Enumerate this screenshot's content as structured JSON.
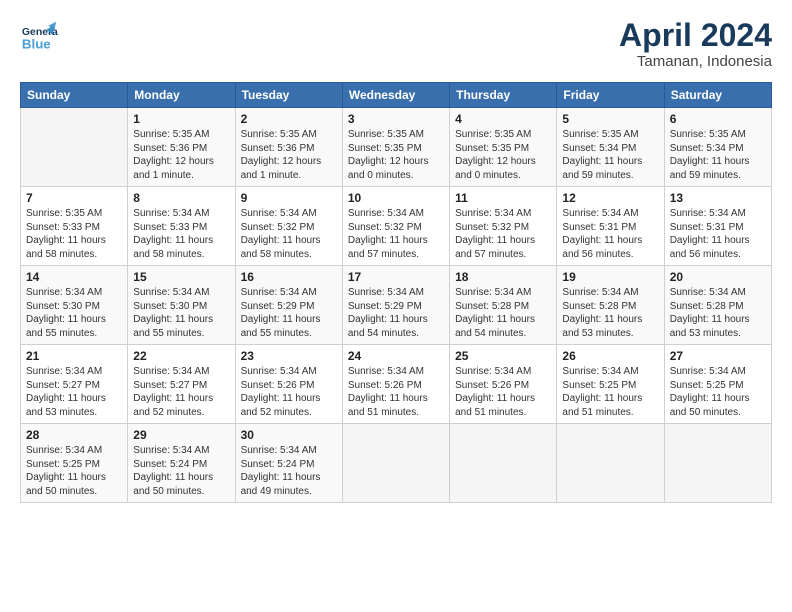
{
  "header": {
    "logo_general": "General",
    "logo_blue": "Blue",
    "title": "April 2024",
    "subtitle": "Tamanan, Indonesia"
  },
  "weekdays": [
    "Sunday",
    "Monday",
    "Tuesday",
    "Wednesday",
    "Thursday",
    "Friday",
    "Saturday"
  ],
  "weeks": [
    [
      {
        "day": "",
        "info": ""
      },
      {
        "day": "1",
        "info": "Sunrise: 5:35 AM\nSunset: 5:36 PM\nDaylight: 12 hours\nand 1 minute."
      },
      {
        "day": "2",
        "info": "Sunrise: 5:35 AM\nSunset: 5:36 PM\nDaylight: 12 hours\nand 1 minute."
      },
      {
        "day": "3",
        "info": "Sunrise: 5:35 AM\nSunset: 5:35 PM\nDaylight: 12 hours\nand 0 minutes."
      },
      {
        "day": "4",
        "info": "Sunrise: 5:35 AM\nSunset: 5:35 PM\nDaylight: 12 hours\nand 0 minutes."
      },
      {
        "day": "5",
        "info": "Sunrise: 5:35 AM\nSunset: 5:34 PM\nDaylight: 11 hours\nand 59 minutes."
      },
      {
        "day": "6",
        "info": "Sunrise: 5:35 AM\nSunset: 5:34 PM\nDaylight: 11 hours\nand 59 minutes."
      }
    ],
    [
      {
        "day": "7",
        "info": "Sunrise: 5:35 AM\nSunset: 5:33 PM\nDaylight: 11 hours\nand 58 minutes."
      },
      {
        "day": "8",
        "info": "Sunrise: 5:34 AM\nSunset: 5:33 PM\nDaylight: 11 hours\nand 58 minutes."
      },
      {
        "day": "9",
        "info": "Sunrise: 5:34 AM\nSunset: 5:32 PM\nDaylight: 11 hours\nand 58 minutes."
      },
      {
        "day": "10",
        "info": "Sunrise: 5:34 AM\nSunset: 5:32 PM\nDaylight: 11 hours\nand 57 minutes."
      },
      {
        "day": "11",
        "info": "Sunrise: 5:34 AM\nSunset: 5:32 PM\nDaylight: 11 hours\nand 57 minutes."
      },
      {
        "day": "12",
        "info": "Sunrise: 5:34 AM\nSunset: 5:31 PM\nDaylight: 11 hours\nand 56 minutes."
      },
      {
        "day": "13",
        "info": "Sunrise: 5:34 AM\nSunset: 5:31 PM\nDaylight: 11 hours\nand 56 minutes."
      }
    ],
    [
      {
        "day": "14",
        "info": "Sunrise: 5:34 AM\nSunset: 5:30 PM\nDaylight: 11 hours\nand 55 minutes."
      },
      {
        "day": "15",
        "info": "Sunrise: 5:34 AM\nSunset: 5:30 PM\nDaylight: 11 hours\nand 55 minutes."
      },
      {
        "day": "16",
        "info": "Sunrise: 5:34 AM\nSunset: 5:29 PM\nDaylight: 11 hours\nand 55 minutes."
      },
      {
        "day": "17",
        "info": "Sunrise: 5:34 AM\nSunset: 5:29 PM\nDaylight: 11 hours\nand 54 minutes."
      },
      {
        "day": "18",
        "info": "Sunrise: 5:34 AM\nSunset: 5:28 PM\nDaylight: 11 hours\nand 54 minutes."
      },
      {
        "day": "19",
        "info": "Sunrise: 5:34 AM\nSunset: 5:28 PM\nDaylight: 11 hours\nand 53 minutes."
      },
      {
        "day": "20",
        "info": "Sunrise: 5:34 AM\nSunset: 5:28 PM\nDaylight: 11 hours\nand 53 minutes."
      }
    ],
    [
      {
        "day": "21",
        "info": "Sunrise: 5:34 AM\nSunset: 5:27 PM\nDaylight: 11 hours\nand 53 minutes."
      },
      {
        "day": "22",
        "info": "Sunrise: 5:34 AM\nSunset: 5:27 PM\nDaylight: 11 hours\nand 52 minutes."
      },
      {
        "day": "23",
        "info": "Sunrise: 5:34 AM\nSunset: 5:26 PM\nDaylight: 11 hours\nand 52 minutes."
      },
      {
        "day": "24",
        "info": "Sunrise: 5:34 AM\nSunset: 5:26 PM\nDaylight: 11 hours\nand 51 minutes."
      },
      {
        "day": "25",
        "info": "Sunrise: 5:34 AM\nSunset: 5:26 PM\nDaylight: 11 hours\nand 51 minutes."
      },
      {
        "day": "26",
        "info": "Sunrise: 5:34 AM\nSunset: 5:25 PM\nDaylight: 11 hours\nand 51 minutes."
      },
      {
        "day": "27",
        "info": "Sunrise: 5:34 AM\nSunset: 5:25 PM\nDaylight: 11 hours\nand 50 minutes."
      }
    ],
    [
      {
        "day": "28",
        "info": "Sunrise: 5:34 AM\nSunset: 5:25 PM\nDaylight: 11 hours\nand 50 minutes."
      },
      {
        "day": "29",
        "info": "Sunrise: 5:34 AM\nSunset: 5:24 PM\nDaylight: 11 hours\nand 50 minutes."
      },
      {
        "day": "30",
        "info": "Sunrise: 5:34 AM\nSunset: 5:24 PM\nDaylight: 11 hours\nand 49 minutes."
      },
      {
        "day": "",
        "info": ""
      },
      {
        "day": "",
        "info": ""
      },
      {
        "day": "",
        "info": ""
      },
      {
        "day": "",
        "info": ""
      }
    ]
  ]
}
